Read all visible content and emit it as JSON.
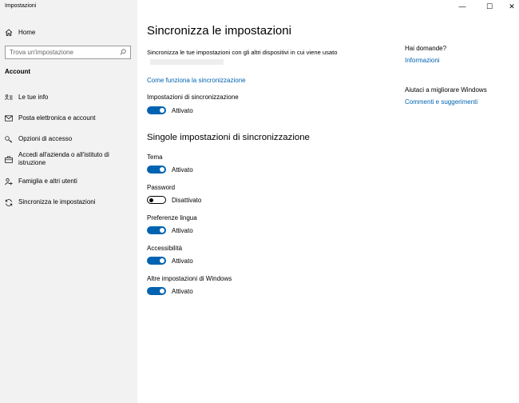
{
  "window": {
    "title": "Impostazioni",
    "minimize_glyph": "—",
    "maximize_glyph": "☐",
    "close_glyph": "✕"
  },
  "sidebar": {
    "home_label": "Home",
    "home_icon": "home-icon",
    "search_placeholder": "Trova un'impostazione",
    "search_icon": "search-icon",
    "section_label": "Account",
    "items": [
      {
        "label": "Le tue info",
        "icon": "person-card-icon"
      },
      {
        "label": "Posta elettronica e account",
        "icon": "mail-icon"
      },
      {
        "label": "Opzioni di accesso",
        "icon": "key-icon"
      },
      {
        "label": "Accedi all'azienda o all'istituto di istruzione",
        "icon": "briefcase-icon"
      },
      {
        "label": "Famiglia e altri utenti",
        "icon": "add-person-icon"
      },
      {
        "label": "Sincronizza le impostazioni",
        "icon": "sync-icon",
        "selected": true
      }
    ]
  },
  "main": {
    "title": "Sincronizza le impostazioni",
    "description": "Sincronizza le tue impostazioni con gli altri dispositivi in cui viene usato",
    "how_link": "Come funziona la sincronizzazione",
    "sync_settings": {
      "label": "Impostazioni di sincronizzazione",
      "state": "Attivato",
      "on": true
    },
    "individual_title": "Singole impostazioni di sincronizzazione",
    "toggles": [
      {
        "label": "Tema",
        "state": "Attivato",
        "on": true
      },
      {
        "label": "Password",
        "state": "Disattivato",
        "on": false
      },
      {
        "label": "Preferenze lingua",
        "state": "Attivato",
        "on": true
      },
      {
        "label": "Accessibilità",
        "state": "Attivato",
        "on": true
      },
      {
        "label": "Altre impostazioni di Windows",
        "state": "Attivato",
        "on": true
      }
    ]
  },
  "aside": {
    "question_heading": "Hai domande?",
    "info_link": "Informazioni",
    "improve_heading": "Aiutaci a migliorare Windows",
    "feedback_link": "Commenti e suggerimenti"
  },
  "colors": {
    "accent": "#0063b1",
    "sidebar_bg": "#f2f2f2"
  }
}
